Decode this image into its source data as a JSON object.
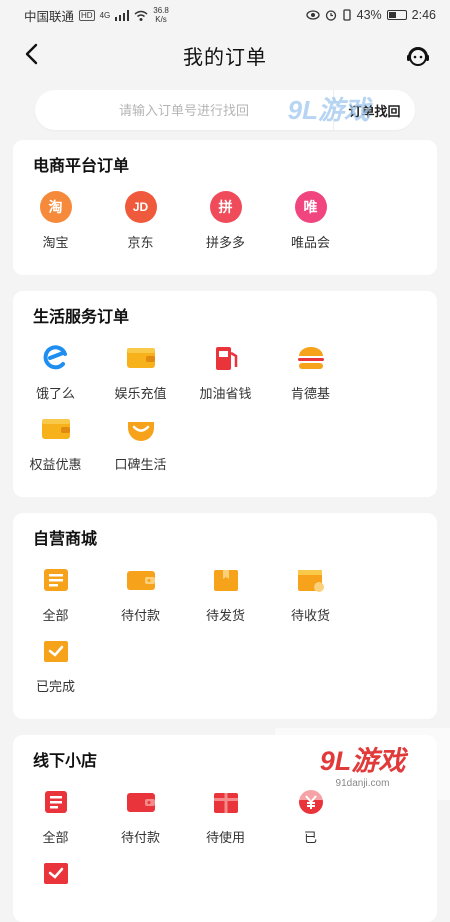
{
  "status": {
    "carrier": "中国联通",
    "hd": "HD",
    "net": "4G",
    "speed_value": "36.8",
    "speed_unit": "K/s",
    "battery": "43%",
    "time": "2:46"
  },
  "header": {
    "title": "我的订单"
  },
  "search": {
    "placeholder": "请输入订单号进行找回",
    "button": "订单找回"
  },
  "watermark_top": "9L游戏",
  "ecommerce": {
    "title": "电商平台订单",
    "items": [
      {
        "label": "淘宝",
        "glyph": "淘",
        "color": "#f58a3a"
      },
      {
        "label": "京东",
        "glyph": "JD",
        "color": "#ef5a3c"
      },
      {
        "label": "拼多多",
        "glyph": "拼",
        "color": "#f04b5a"
      },
      {
        "label": "唯品会",
        "glyph": "唯",
        "color": "#f0457e"
      }
    ]
  },
  "life": {
    "title": "生活服务订单",
    "items": [
      {
        "label": "饿了么",
        "icon": "eleme-icon"
      },
      {
        "label": "娱乐充值",
        "icon": "wallet-icon"
      },
      {
        "label": "加油省钱",
        "icon": "fuel-pump-icon"
      },
      {
        "label": "肯德基",
        "icon": "burger-icon"
      },
      {
        "label": "权益优惠",
        "icon": "coupon-card-icon"
      },
      {
        "label": "口碑生活",
        "icon": "smile-icon"
      }
    ]
  },
  "mall": {
    "title": "自营商城",
    "items": [
      {
        "label": "全部",
        "icon": "list-icon"
      },
      {
        "label": "待付款",
        "icon": "wallet-icon"
      },
      {
        "label": "待发货",
        "icon": "box-icon"
      },
      {
        "label": "待收货",
        "icon": "delivery-box-icon"
      },
      {
        "label": "已完成",
        "icon": "check-box-icon"
      }
    ]
  },
  "store": {
    "title": "线下小店",
    "items": [
      {
        "label": "全部",
        "icon": "list-icon"
      },
      {
        "label": "待付款",
        "icon": "wallet-icon"
      },
      {
        "label": "待使用",
        "icon": "gift-ticket-icon"
      },
      {
        "label": "已",
        "icon": "yuan-circle-icon"
      },
      {
        "label": "",
        "icon": "check-box-icon"
      }
    ]
  },
  "watermark_bottom": {
    "logo": "9L游戏",
    "url": "91danji.com"
  },
  "colors": {
    "orange": "#f7a21b",
    "red": "#e8343a",
    "eleme_blue": "#1e8ff0"
  }
}
